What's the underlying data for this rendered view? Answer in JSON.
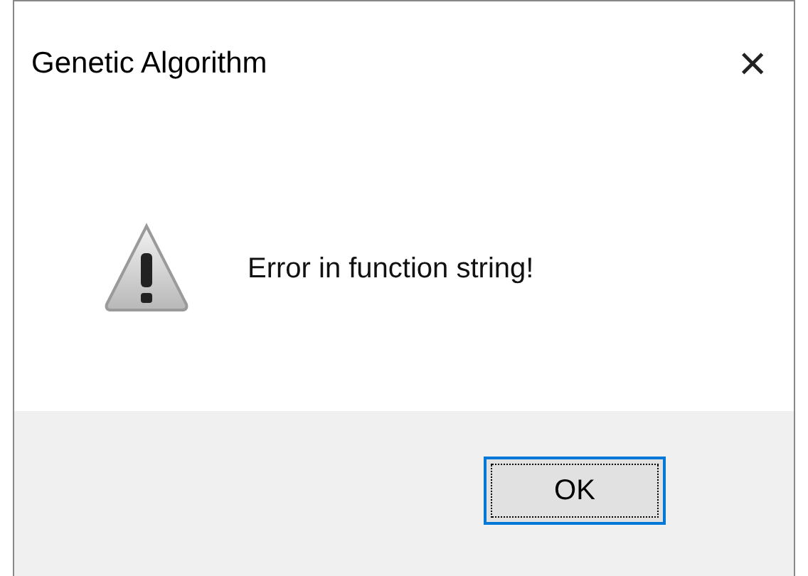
{
  "window": {
    "title": "Genetic Algorithm",
    "close": "×"
  },
  "message": "Error in function string!",
  "buttons": [
    {
      "label": "OK",
      "focused": true
    }
  ]
}
